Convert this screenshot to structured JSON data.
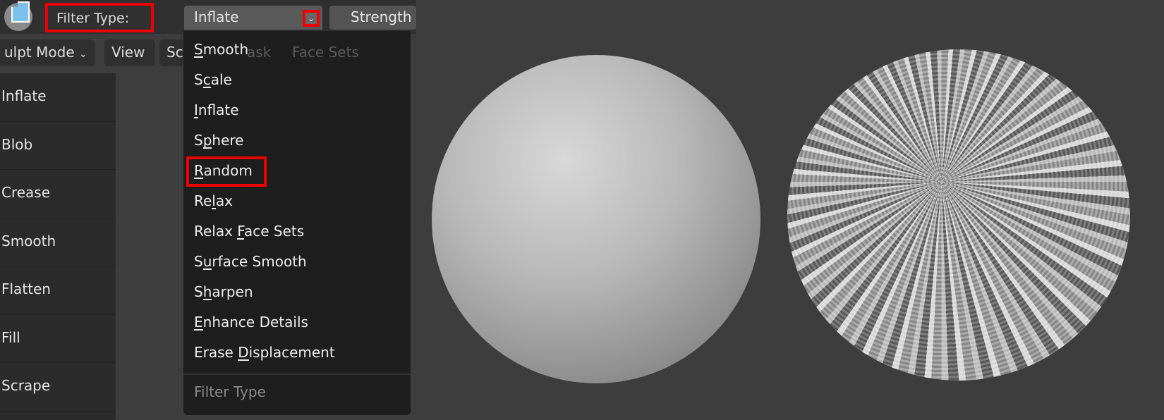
{
  "header": {
    "filter_type_label": "Filter Type:",
    "selected_filter": "Inflate",
    "strength_label": "Strength"
  },
  "toolbar": {
    "mode": "ulpt Mode",
    "view": "View",
    "sculpt_partial": "Sc",
    "mask_partial": "ask",
    "face_sets": "Face Sets"
  },
  "sidebar": {
    "tools": [
      "Inflate",
      "Blob",
      "Crease",
      "Smooth",
      "Flatten",
      "Fill",
      "Scrape"
    ]
  },
  "menu": {
    "title": "Filter Type",
    "items": [
      {
        "label": "Smooth",
        "underline": 0
      },
      {
        "label": "Scale",
        "underline": 1
      },
      {
        "label": "Inflate",
        "underline": 0
      },
      {
        "label": "Sphere",
        "underline": 1
      },
      {
        "label": "Random",
        "underline": 0,
        "highlighted": true
      },
      {
        "label": "Relax",
        "underline": 2
      },
      {
        "label": "Relax Face Sets",
        "underline": 6
      },
      {
        "label": "Surface Smooth",
        "underline": 1
      },
      {
        "label": "Sharpen",
        "underline": 1
      },
      {
        "label": "Enhance Details",
        "underline": 0
      },
      {
        "label": "Erase Displacement",
        "underline": 6
      }
    ]
  },
  "colors": {
    "highlight": "#e00000",
    "menu_bg": "#1e1e1e",
    "viewport_bg": "#3d3d3d"
  }
}
